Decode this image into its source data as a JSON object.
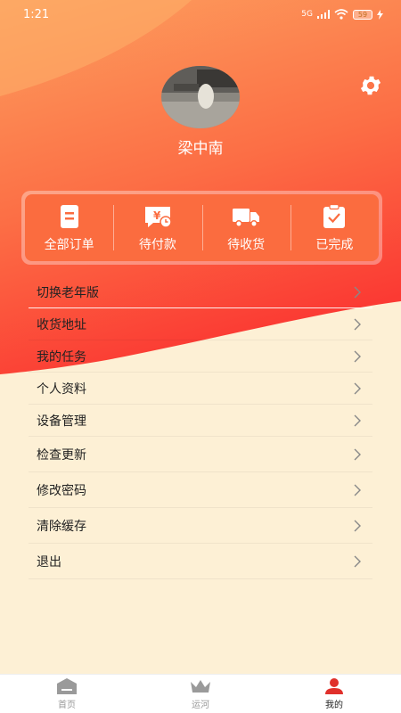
{
  "status_bar": {
    "time": "1:21",
    "network": "5G",
    "battery": "59"
  },
  "profile": {
    "username": "梁中南"
  },
  "orders": [
    {
      "label": "全部订单",
      "icon": "order-list-icon"
    },
    {
      "label": "待付款",
      "icon": "payment-pending-icon"
    },
    {
      "label": "待收货",
      "icon": "truck-icon"
    },
    {
      "label": "已完成",
      "icon": "clipboard-check-icon"
    }
  ],
  "menu": [
    {
      "label": "切换老年版"
    },
    {
      "label": "收货地址"
    },
    {
      "label": "我的任务"
    },
    {
      "label": "个人资料"
    },
    {
      "label": "设备管理"
    },
    {
      "label": "检查更新"
    },
    {
      "label": "修改密码"
    },
    {
      "label": "清除缓存"
    },
    {
      "label": "退出"
    }
  ],
  "tabbar": [
    {
      "label": "首页",
      "icon": "home-icon",
      "active": false
    },
    {
      "label": "运河",
      "icon": "crown-icon",
      "active": false
    },
    {
      "label": "我的",
      "icon": "user-icon",
      "active": true
    }
  ],
  "colors": {
    "accent": "#fb6c3f",
    "header_top": "#fca15f",
    "header_bottom": "#fb3a33",
    "page_bg": "#fdf0d5",
    "active_tab": "#e0302b"
  }
}
